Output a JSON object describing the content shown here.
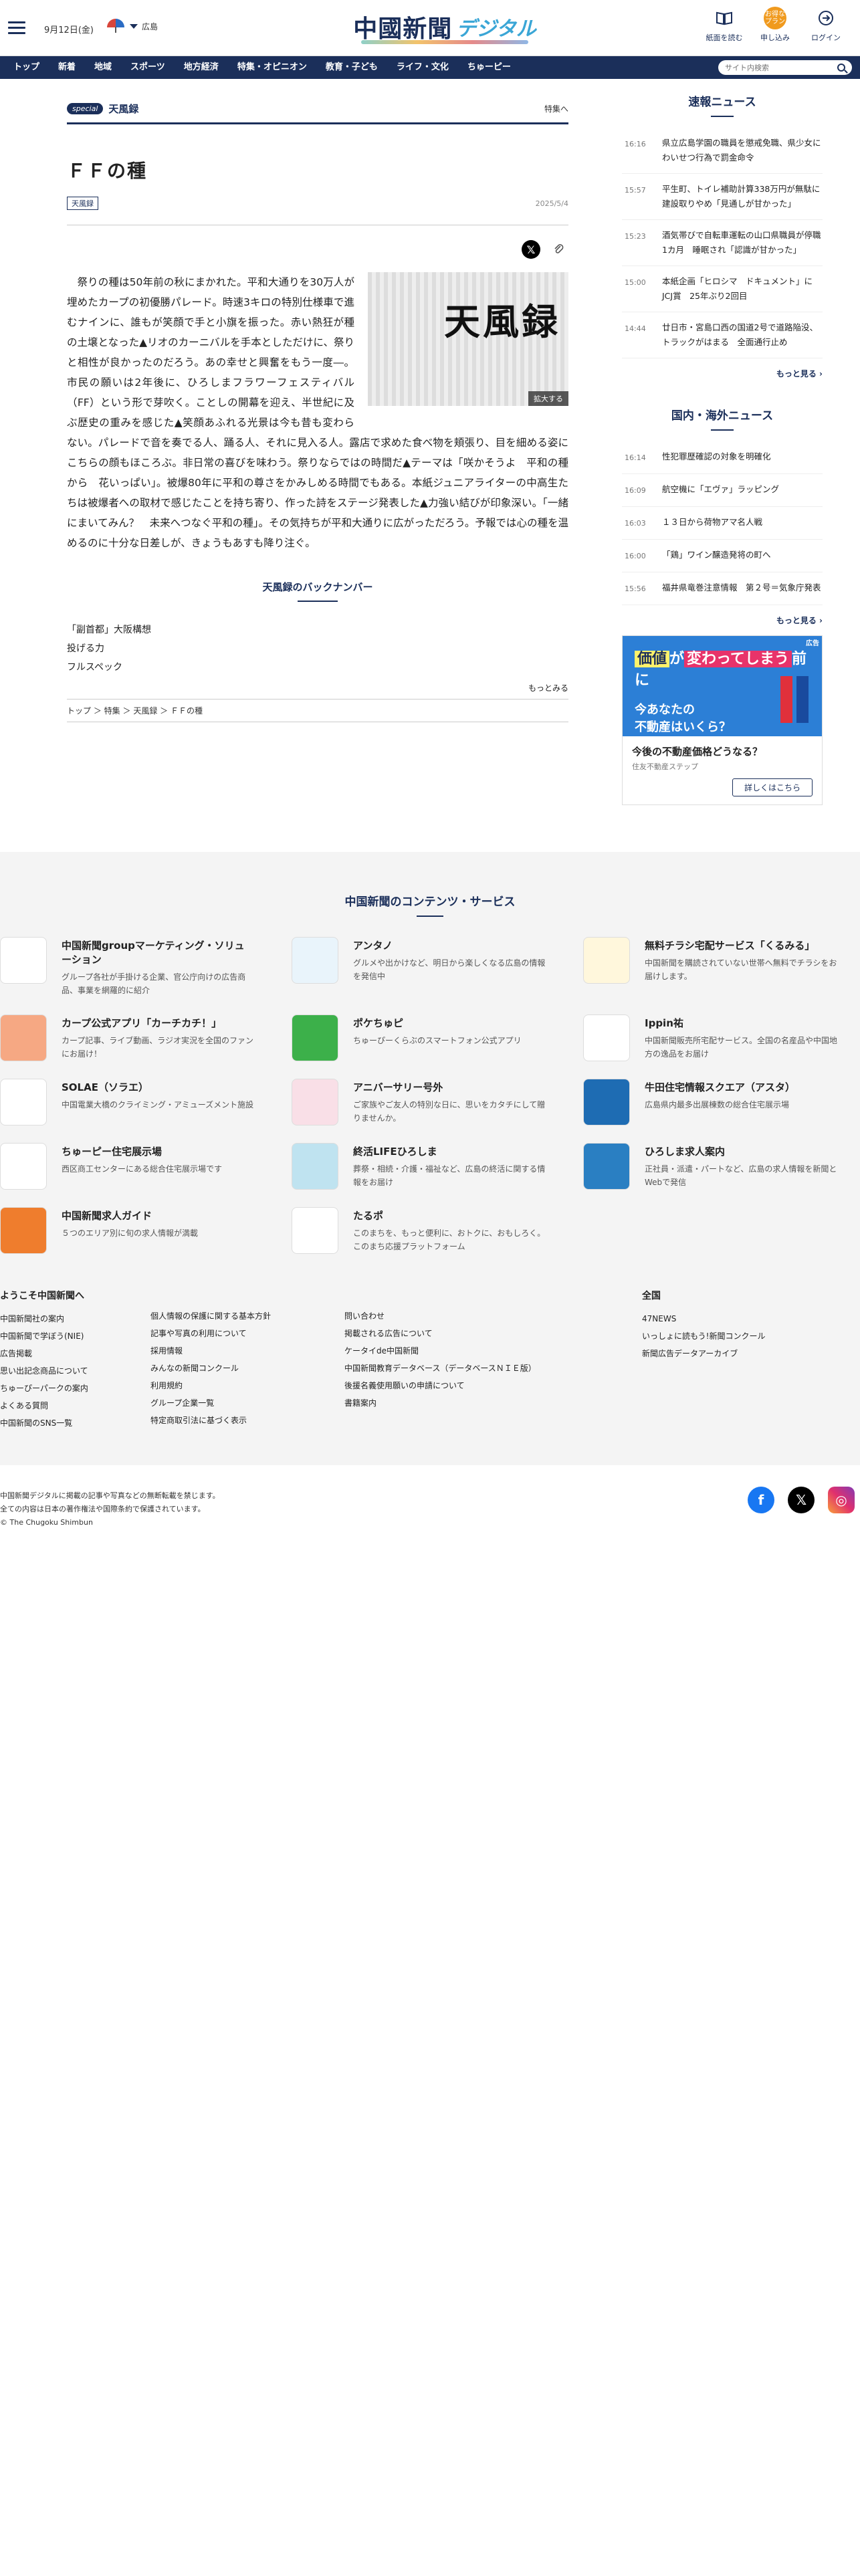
{
  "header": {
    "date": "9月12日(金)",
    "weather_area": "広島",
    "logo_main": "中國新聞",
    "logo_sub": "デジタル",
    "icons": [
      {
        "label": "紙面を読む",
        "icon": "newspaper-icon"
      },
      {
        "label": "申し込み",
        "badge": "お得なプラン",
        "icon": "apply-icon"
      },
      {
        "label": "ログイン",
        "icon": "login-icon"
      }
    ]
  },
  "nav": {
    "items": [
      "トップ",
      "新着",
      "地域",
      "スポーツ",
      "地方経済",
      "特集・オピニオン",
      "教育・子ども",
      "ライフ・文化",
      "ちゅーピー"
    ],
    "search_placeholder": "サイト内検索"
  },
  "article": {
    "special_tag": "special",
    "special_title": "天風録",
    "special_link": "特集へ",
    "title": "ＦＦの種",
    "category": "天風録",
    "date": "2025/5/4",
    "photo_text": "天風録",
    "photo_zoom": "拡大する",
    "body": "祭りの種は50年前の秋にまかれた。平和大通りを30万人が埋めたカープの初優勝パレード。時速3キロの特別仕様車で進むナインに、誰もが笑顔で手と小旗を振った。赤い熱狂が種の土壌となった▲リオのカーニバルを手本としただけに、祭りと相性が良かったのだろう。あの幸せと興奮をもう一度―。市民の願いは2年後に、ひろしまフラワーフェスティバル（FF）という形で芽吹く。ことしの開幕を迎え、半世紀に及ぶ歴史の重みを感じた▲笑顔あふれる光景は今も昔も変わらない。パレードで音を奏でる人、踊る人、それに見入る人。露店で求めた食べ物を頬張り、目を細める姿にこちらの顔もほころぶ。非日常の喜びを味わう。祭りならではの時間だ▲テーマは「咲かそうよ　平和の種から　花いっぱい」。被爆80年に平和の尊さをかみしめる時間でもある。本紙ジュニアライターの中高生たちは被爆者への取材で感じたことを持ち寄り、作った詩をステージ発表した▲力強い結びが印象深い。「一緒にまいてみん？　未来へつなぐ平和の種」。その気持ちが平和大通りに広がっただろう。予報では心の種を温めるのに十分な日差しが、きょうもあすも降り注ぐ。",
    "backnumber_heading": "天風録のバックナンバー",
    "backnumbers": [
      "「副首都」大阪構想",
      "投げる力",
      "フルスペック"
    ],
    "backnumber_more": "もっとみる",
    "breadcrumb": [
      "トップ",
      "特集",
      "天風録",
      "ＦＦの種"
    ]
  },
  "sidebar": {
    "breaking_heading": "速報ニュース",
    "breaking": [
      {
        "time": "16:16",
        "title": "県立広島学園の職員を懲戒免職、県少女にわいせつ行為で罰金命令"
      },
      {
        "time": "15:57",
        "title": "平生町、トイレ補助計算338万円が無駄に　建設取りやめ「見通しが甘かった」"
      },
      {
        "time": "15:23",
        "title": "酒気帯びで自転車運転の山口県職員が停職1カ月　睡眠され「認識が甘かった」"
      },
      {
        "time": "15:00",
        "title": "本紙企画「ヒロシマ　ドキュメント」にJCJ賞　25年ぶり2回目"
      },
      {
        "time": "14:44",
        "title": "廿日市・宮島口西の国道2号で道路陥没、トラックがはまる　全面通行止め"
      }
    ],
    "breaking_more": "もっと見る",
    "world_heading": "国内・海外ニュース",
    "world": [
      {
        "time": "16:14",
        "title": "性犯罪歴確認の対象を明確化"
      },
      {
        "time": "16:09",
        "title": "航空機に「エヴァ」ラッピング"
      },
      {
        "time": "16:03",
        "title": "１３日から荷物アマ名人戦"
      },
      {
        "time": "16:00",
        "title": "「鶏」ワイン醸造発将の町へ"
      },
      {
        "time": "15:56",
        "title": "福井県竜巻注意情報　第２号＝気象庁発表"
      }
    ],
    "world_more": "もっと見る",
    "ad": {
      "line1_a": "価値",
      "line1_b": "が",
      "line1_c": "変わってしまう",
      "line1_d": "前に",
      "line2": "今あなたの\n不動産はいくら？",
      "badge": "広告",
      "title": "今後の不動産価格どうなる？",
      "sponsor": "住友不動産ステップ",
      "button": "詳しくはこちら"
    }
  },
  "services": {
    "heading": "中国新聞のコンテンツ・サービス",
    "items": [
      {
        "name": "中国新聞groupマーケティング・ソリューション",
        "desc": "グループ各社が手掛ける企業、官公庁向けの広告商品、事業を網羅的に紹介",
        "color": "#ffffff"
      },
      {
        "name": "アンタノ",
        "desc": "グルメや出かけなど、明日から楽しくなる広島の情報を発信中",
        "color": "#e9f4fb"
      },
      {
        "name": "無料チラシ宅配サービス「くるみる」",
        "desc": "中国新聞を購読されていない世帯へ無料でチラシをお届けします。",
        "color": "#fff7dc"
      },
      {
        "name": "カープ公式アプリ「カーチカチ！」",
        "desc": "カープ記事、ライブ動画、ラジオ実況を全国のファンにお届け！",
        "color": "#f6a883"
      },
      {
        "name": "ポケちゅピ",
        "desc": "ちゅーぴーくらぶのスマートフォン公式アプリ",
        "color": "#3cb04a"
      },
      {
        "name": "Ippin祐",
        "desc": "中国新聞販売所宅配サービス。全国の名産品や中国地方の逸品をお届け",
        "color": "#ffffff"
      },
      {
        "name": "SOLAE（ソラエ）",
        "desc": "中国電業大橋のクライミング・アミューズメント施設",
        "color": "#ffffff"
      },
      {
        "name": "アニバーサリー号外",
        "desc": "ご家族やご友人の特別な日に、思いをカタチにして贈りませんか。",
        "color": "#f9dfe7"
      },
      {
        "name": "牛田住宅情報スクエア（アスタ）",
        "desc": "広島県内最多出展棟数の総合住宅展示場",
        "color": "#1e6cb3"
      },
      {
        "name": "ちゅーピー住宅展示場",
        "desc": "西区商工センターにある総合住宅展示場です",
        "color": "#ffffff"
      },
      {
        "name": "終活LIFEひろしま",
        "desc": "葬祭・相続・介護・福祉など、広島の終活に関する情報をお届け",
        "color": "#bfe3f0"
      },
      {
        "name": "ひろしま求人案内",
        "desc": "正社員・派遣・パートなど、広島の求人情報を新聞とWebで発信",
        "color": "#2a7fc2"
      },
      {
        "name": "中国新聞求人ガイド",
        "desc": "５つのエリア別に旬の求人情報が満載",
        "color": "#ef7d2d"
      },
      {
        "name": "たるポ",
        "desc": "このまちを、もっと便利に、おトクに、おもしろく。このまち応援プラットフォーム",
        "color": "#ffffff"
      }
    ]
  },
  "footer_links": {
    "col1_heading": "ようこそ中国新聞へ",
    "col1": [
      "中国新聞社の案内",
      "中国新聞で学ぼう(NIE)",
      "広告掲載",
      "思い出記念商品について",
      "ちゅーぴーパークの案内",
      "よくある質問",
      "中国新聞のSNS一覧"
    ],
    "col2": [
      "個人情報の保護に関する基本方針",
      "記事や写真の利用について",
      "採用情報",
      "みんなの新聞コンクール",
      "利用規約",
      "グループ企業一覧",
      "特定商取引法に基づく表示"
    ],
    "col3": [
      "問い合わせ",
      "掲載される広告について",
      "ケータイde中国新聞",
      "中国新聞教育データベース（データベースＮＩＥ版）",
      "後援名義使用願いの申請について",
      "書籍案内"
    ],
    "col4_heading": "全国",
    "col4": [
      "47NEWS",
      "いっしょに読もう!新聞コンクール",
      "新聞広告データアーカイブ"
    ]
  },
  "footer": {
    "copy1": "中国新聞デジタルに掲載の記事や写真などの無断転載を禁じます。",
    "copy2": "全ての内容は日本の著作権法や国際条約で保護されています。",
    "copy3": "© The Chugoku Shimbun"
  }
}
